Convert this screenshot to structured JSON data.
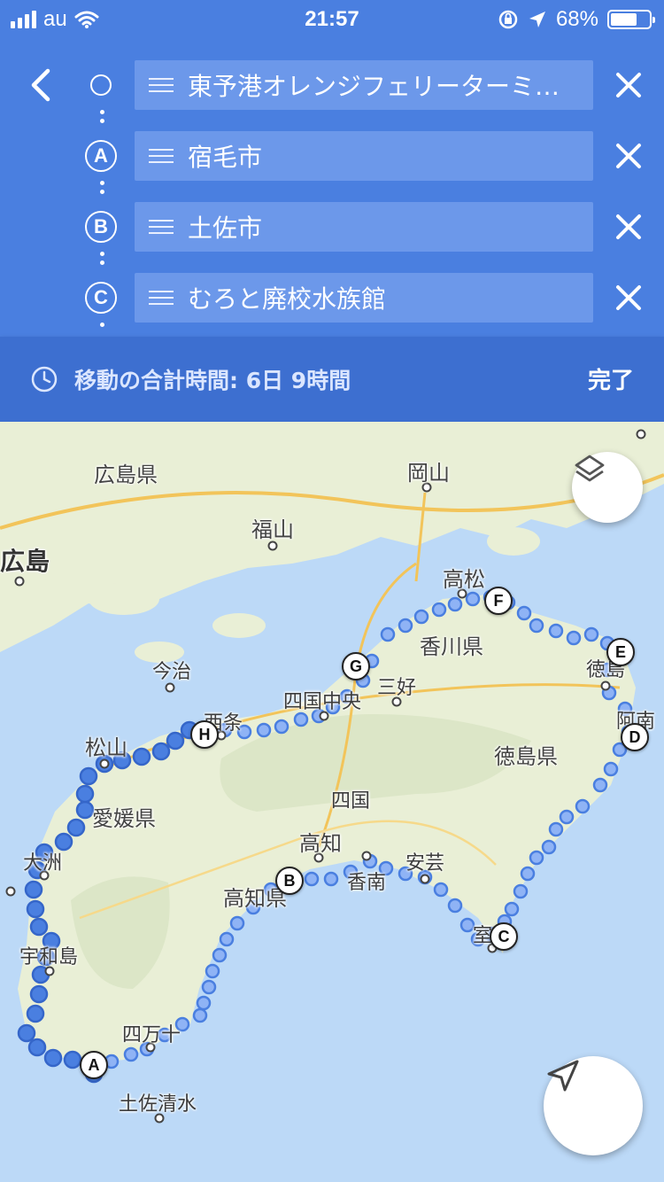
{
  "status_bar": {
    "carrier": "au",
    "time": "21:57",
    "battery": "68%",
    "battery_level": 0.68
  },
  "directions": {
    "stops": [
      {
        "marker": "",
        "label": "東予港オレンジフェリーターミ…"
      },
      {
        "marker": "A",
        "label": "宿毛市"
      },
      {
        "marker": "B",
        "label": "土佐市"
      },
      {
        "marker": "C",
        "label": "むろと廃校水族館"
      }
    ],
    "summary": "移動の合計時間: 6日 9時間",
    "done_label": "完了"
  },
  "map": {
    "labels": {
      "hiroshima_pref": "広島県",
      "okayama": "岡山",
      "fukuyama": "福山",
      "hiroshima": "広島",
      "takamatsu": "高松",
      "kagawa_pref": "香川県",
      "imabari": "今治",
      "shikoku_chuo": "四国中央",
      "miyoshi": "三好",
      "tokushima": "徳島",
      "anan": "阿南",
      "saijo": "西条",
      "matsuyama": "松山",
      "tokushima_pref": "徳島県",
      "ehime_pref": "愛媛県",
      "shikoku": "四国",
      "ozu": "大洲",
      "kochi": "高知",
      "aki": "安芸",
      "konan": "香南",
      "kochi_pref": "高知県",
      "uwajima": "宇和島",
      "muroto": "室戸",
      "shimanto": "四万十",
      "tosashimizu": "土佐清水"
    },
    "waypoints": [
      "A",
      "B",
      "C",
      "D",
      "E",
      "F",
      "G",
      "H"
    ],
    "colors": {
      "route_dark": "#4a7fe0",
      "route_light": "#8fb3f5",
      "sea": "#bcd9f7",
      "land": "#e9efd6",
      "header": "#4a7fe0"
    }
  }
}
